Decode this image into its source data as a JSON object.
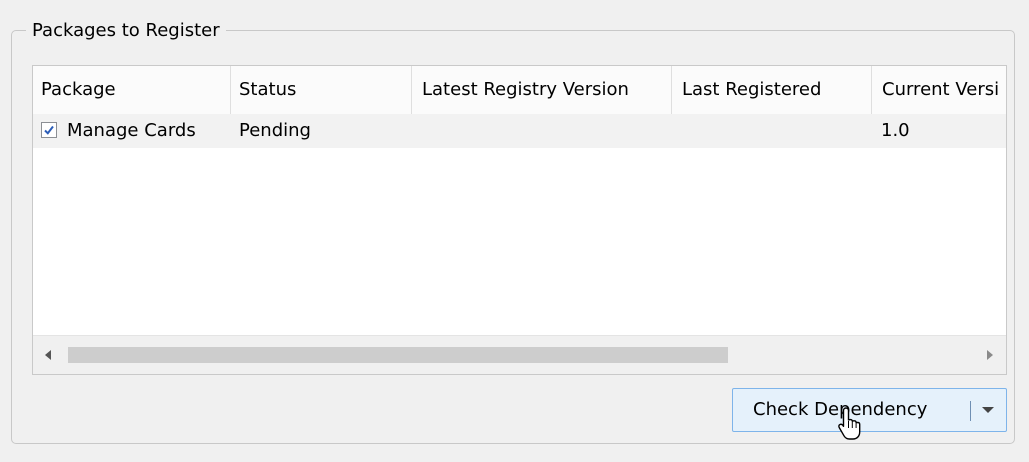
{
  "group": {
    "title": "Packages to Register"
  },
  "table": {
    "columns": [
      "Package",
      "Status",
      "Latest Registry Version",
      "Last Registered",
      "Current Versi"
    ],
    "rows": [
      {
        "checked": true,
        "package": "Manage Cards",
        "status": "Pending",
        "latest_registry_version": "",
        "last_registered": "",
        "current_version": "1.0"
      }
    ]
  },
  "button": {
    "label": "Check Dependency",
    "accent": "#e5f1fb",
    "border": "#7eb4ea"
  },
  "icons": {
    "checkbox": "checkmark-icon",
    "scroll_left": "triangle-left-icon",
    "scroll_right": "triangle-right-icon",
    "dropdown": "chevron-down-icon",
    "cursor": "mouse-pointer-icon"
  }
}
